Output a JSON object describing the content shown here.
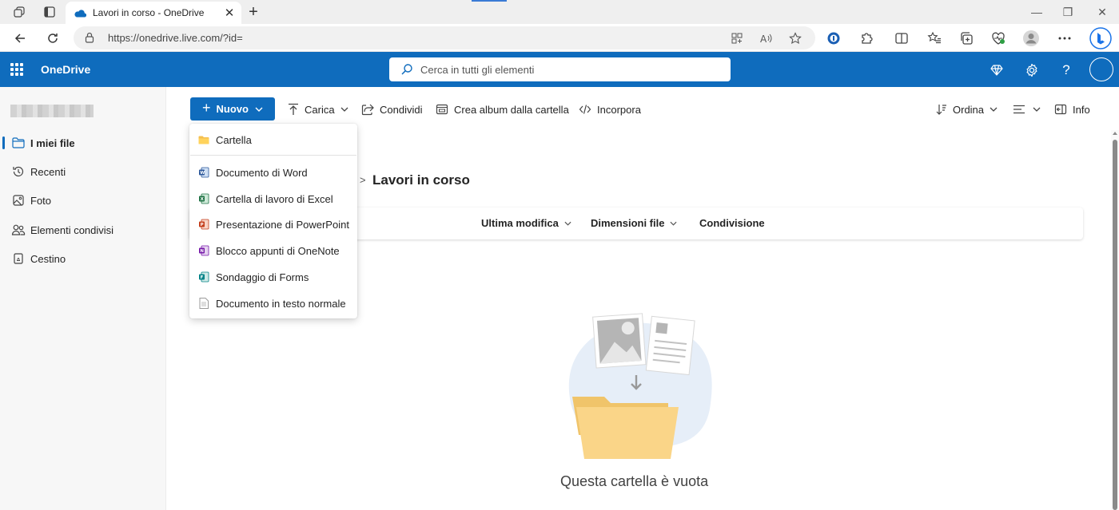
{
  "browser": {
    "tab_title": "Lavori in corso - OneDrive",
    "tab_close": "✕",
    "new_tab": "+",
    "url": "https://onedrive.live.com/?id=",
    "window_controls": [
      "—",
      "❐",
      "✕"
    ]
  },
  "header": {
    "app_name": "OneDrive",
    "search_placeholder": "Cerca in tutti gli elementi",
    "accent_color": "#0f6cbd"
  },
  "sidebar": {
    "items": [
      {
        "label": "I miei file",
        "icon": "folder-icon",
        "active": true
      },
      {
        "label": "Recenti",
        "icon": "history-icon",
        "active": false
      },
      {
        "label": "Foto",
        "icon": "image-icon",
        "active": false
      },
      {
        "label": "Elementi condivisi",
        "icon": "people-icon",
        "active": false
      },
      {
        "label": "Cestino",
        "icon": "recycle-bin-icon",
        "active": false
      }
    ]
  },
  "commands": {
    "new": "Nuovo",
    "upload": "Carica",
    "share": "Condividi",
    "album": "Crea album dalla cartella",
    "embed": "Incorpora",
    "sort": "Ordina",
    "info": "Info"
  },
  "new_menu": {
    "items": [
      {
        "label": "Cartella",
        "icon": "folder-icon"
      },
      {
        "label": "Documento di Word",
        "icon": "word-icon"
      },
      {
        "label": "Cartella di lavoro di Excel",
        "icon": "excel-icon"
      },
      {
        "label": "Presentazione di PowerPoint",
        "icon": "powerpoint-icon"
      },
      {
        "label": "Blocco appunti di OneNote",
        "icon": "onenote-icon"
      },
      {
        "label": "Sondaggio di Forms",
        "icon": "forms-icon"
      },
      {
        "label": "Documento in testo normale",
        "icon": "text-file-icon"
      }
    ]
  },
  "main": {
    "title": "Lavori in corso",
    "breadcrumb_separator": ">",
    "columns": [
      "Ultima modifica",
      "Dimensioni file",
      "Condivisione"
    ],
    "empty_message": "Questa cartella è vuota"
  }
}
